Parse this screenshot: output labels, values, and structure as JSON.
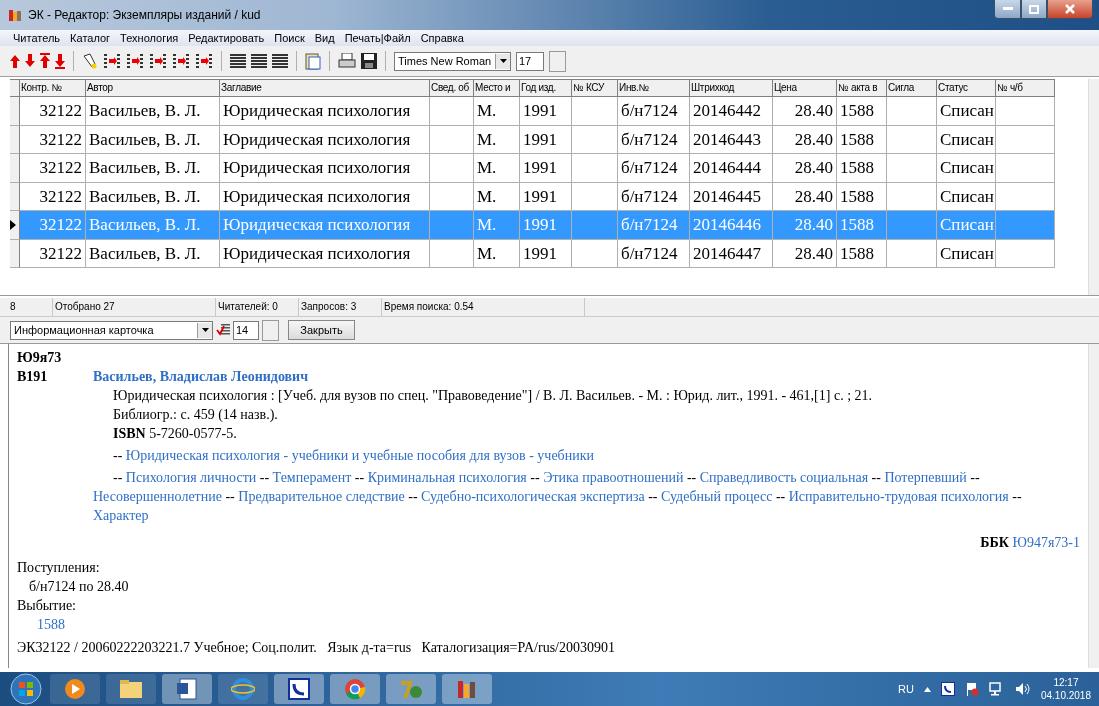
{
  "window": {
    "title": "ЭК - Редактор: Экземпляры изданий / kud"
  },
  "menu": [
    "Читатель",
    "Каталог",
    "Технология",
    "Редактировать",
    "Поиск",
    "Вид",
    "Печать|Файл",
    "Справка"
  ],
  "toolbar": {
    "font": "Times New Roman",
    "size": "17"
  },
  "table": {
    "columns": [
      {
        "label": "Контр. №"
      },
      {
        "label": "Автор"
      },
      {
        "label": "Заглавие"
      },
      {
        "label": "Свед. об"
      },
      {
        "label": "Место и"
      },
      {
        "label": "Год изд."
      },
      {
        "label": "№ КСУ"
      },
      {
        "label": "Инв.№"
      },
      {
        "label": "Штрихкод"
      },
      {
        "label": "Цена"
      },
      {
        "label": "№ акта в"
      },
      {
        "label": "Сигла"
      },
      {
        "label": "Статус"
      },
      {
        "label": "№ ч/б"
      }
    ],
    "rows": [
      {
        "selected": false,
        "cells": [
          "32122",
          "Васильев, В. Л.",
          "Юридическая психология",
          "",
          "М.",
          "1991",
          "",
          "б/н7124",
          "20146442",
          "28.40",
          "1588",
          "",
          "Списан",
          ""
        ]
      },
      {
        "selected": false,
        "cells": [
          "32122",
          "Васильев, В. Л.",
          "Юридическая психология",
          "",
          "М.",
          "1991",
          "",
          "б/н7124",
          "20146443",
          "28.40",
          "1588",
          "",
          "Списан",
          ""
        ]
      },
      {
        "selected": false,
        "cells": [
          "32122",
          "Васильев, В. Л.",
          "Юридическая психология",
          "",
          "М.",
          "1991",
          "",
          "б/н7124",
          "20146444",
          "28.40",
          "1588",
          "",
          "Списан",
          ""
        ]
      },
      {
        "selected": false,
        "cells": [
          "32122",
          "Васильев, В. Л.",
          "Юридическая психология",
          "",
          "М.",
          "1991",
          "",
          "б/н7124",
          "20146445",
          "28.40",
          "1588",
          "",
          "Списан",
          ""
        ]
      },
      {
        "selected": true,
        "cells": [
          "32122",
          "Васильев, В. Л.",
          "Юридическая психология",
          "",
          "М.",
          "1991",
          "",
          "б/н7124",
          "20146446",
          "28.40",
          "1588",
          "",
          "Списан",
          ""
        ]
      },
      {
        "selected": false,
        "cells": [
          "32122",
          "Васильев, В. Л.",
          "Юридическая психология",
          "",
          "М.",
          "1991",
          "",
          "б/н7124",
          "20146447",
          "28.40",
          "1588",
          "",
          "Списан",
          ""
        ]
      }
    ]
  },
  "status_bar": [
    "8",
    "Отобрано 27",
    "Читателей: 0",
    "Запросов: 3",
    "Время поиска: 0.54"
  ],
  "card_toolbar": {
    "view": "Информационная карточка",
    "size": "14",
    "close_button": "Закрыть"
  },
  "card": {
    "class_code": "Ю9я73",
    "author_code": "В191",
    "author": "Васильев, Владислав Леонидович",
    "description": [
      "Юридическая психология : [Учеб. для вузов по спец. \"Правоведение\"] / В. Л. Васильев. - М. : Юрид. лит., 1991. - 461,[1] с. ; 21.",
      "Библиогр.: с. 459 (14 назв.).",
      "**ISBN** 5-7260-0577-5."
    ],
    "subject_groups": [
      [
        {
          "prefix": "--",
          "term": "Юридическая психология - учебники и учебные пособия для вузов - учебники"
        }
      ],
      [
        {
          "prefix": "--",
          "term": "Психология личности"
        },
        {
          "prefix": "--",
          "term": "Темперамент"
        },
        {
          "prefix": "--",
          "term": "Криминальная психология"
        },
        {
          "prefix": "--",
          "term": "Этика правоотношений"
        },
        {
          "prefix": "--",
          "term": "Справедливость социальная"
        },
        {
          "prefix": "--",
          "term": "Потерпевший"
        },
        {
          "prefix": "--",
          "term": "Несовершеннолетние"
        },
        {
          "prefix": "--",
          "term": "Предварительное следствие"
        },
        {
          "prefix": "--",
          "term": "Судебно-психологическая экспертиза"
        },
        {
          "prefix": "--",
          "term": "Судебный процесс"
        },
        {
          "prefix": "--",
          "term": "Исправительно-трудовая психология"
        },
        {
          "prefix": "--",
          "term": "Характер"
        }
      ]
    ],
    "bbk_label": "ББК",
    "bbk_code": "Ю947я73-1",
    "acquisitions_label": "Поступления:",
    "acquisitions": "б/н7124 по 28.40",
    "disposal_label": "Выбытие:",
    "disposal": "1588",
    "footer": "ЭК32122 / 20060222203221.7 Учебное; Соц.полит.   Язык д-та=rus   Каталогизация=PA/rus/20030901"
  },
  "taskbar": {
    "language": "RU",
    "time": "12:17",
    "date": "04.10.2018"
  }
}
